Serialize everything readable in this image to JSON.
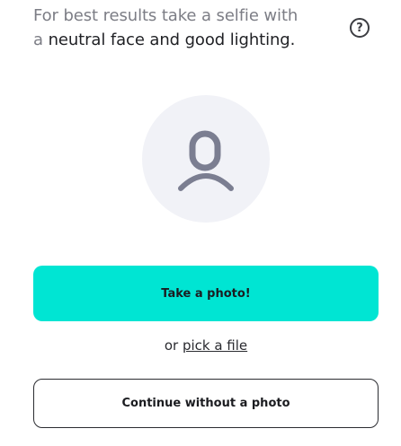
{
  "instruction": {
    "line1": "For best results take a selfie with",
    "line2_prefix": "a ",
    "line2_emphasis": "neutral face and good lighting."
  },
  "help": {
    "icon": "question-circle-icon",
    "glyph": "?"
  },
  "avatar": {
    "icon": "person-placeholder-icon"
  },
  "buttons": {
    "take_photo": "Take a photo!",
    "continue_without": "Continue without a photo"
  },
  "file_option": {
    "prefix": "or ",
    "link": "pick a file"
  },
  "colors": {
    "primary": "#00e5d3",
    "avatar_bg": "#f1f2f7",
    "avatar_icon": "#7b7e91",
    "muted_text": "#7c7d85",
    "dark_text": "#1f2024"
  }
}
